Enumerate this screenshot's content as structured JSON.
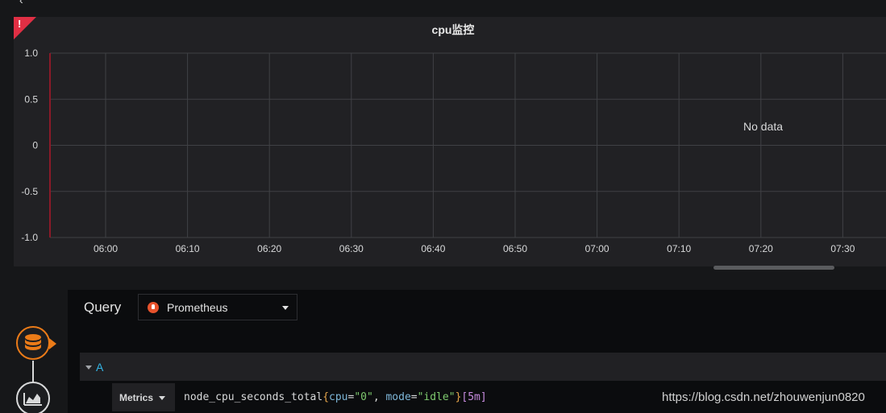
{
  "panel": {
    "title": "cpu监控",
    "alert_mark": "!",
    "no_data": "No data"
  },
  "chart_data": {
    "type": "line",
    "y_ticks": [
      "1.0",
      "0.5",
      "0",
      "-0.5",
      "-1.0"
    ],
    "x_ticks": [
      "06:00",
      "06:10",
      "06:20",
      "06:30",
      "06:40",
      "06:50",
      "07:00",
      "07:10",
      "07:20",
      "07:30"
    ],
    "ylim": [
      -1.0,
      1.0
    ],
    "series": [],
    "grid": true
  },
  "query_editor": {
    "label": "Query",
    "datasource": "Prometheus",
    "row_ref": "A",
    "metrics_button": "Metrics",
    "expr": {
      "metric": "node_cpu_seconds_total",
      "open_brace": "{",
      "l1": "cpu",
      "eq1": "=",
      "v1": "\"0\"",
      "sep": ", ",
      "l2": "mode",
      "eq2": "=",
      "v2": "\"idle\"",
      "close_brace": "}",
      "range": "[5m]"
    }
  },
  "watermark": "https://blog.csdn.net/zhouwenjun0820",
  "colors": {
    "alert": "#e02f44",
    "accent_orange": "#eb7b18",
    "prometheus": "#e6522c",
    "row_ref": "#33b5e5"
  },
  "icons": [
    "alert-icon",
    "prometheus-icon",
    "database-icon",
    "visualization-icon",
    "caret-down-icon"
  ]
}
